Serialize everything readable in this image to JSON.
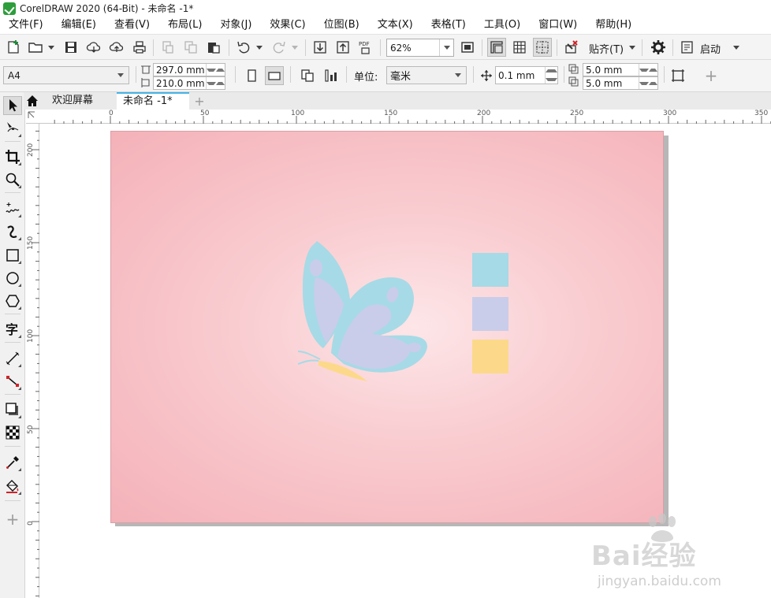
{
  "window": {
    "title": "CorelDRAW 2020 (64-Bit) - 未命名 -1*"
  },
  "menu": [
    "文件(F)",
    "编辑(E)",
    "查看(V)",
    "布局(L)",
    "对象(J)",
    "效果(C)",
    "位图(B)",
    "文本(X)",
    "表格(T)",
    "工具(O)",
    "窗口(W)",
    "帮助(H)"
  ],
  "toolbar": {
    "zoom": "62%",
    "snap_label": "贴齐(T)",
    "launch_label": "启动",
    "pdf_label": "PDF"
  },
  "propertybar": {
    "page_size": "A4",
    "width": "297.0 mm",
    "height": "210.0 mm",
    "unit_label": "单位:",
    "unit": "毫米",
    "nudge": "0.1 mm",
    "dup_x": "5.0 mm",
    "dup_y": "5.0 mm"
  },
  "tabs": {
    "welcome": "欢迎屏幕",
    "document": "未命名 -1*"
  },
  "ruler": {
    "h_labels": [
      "0",
      "50",
      "100",
      "150",
      "200",
      "250",
      "300",
      "350"
    ],
    "v_labels": [
      "200",
      "150",
      "100",
      "50",
      "0"
    ],
    "unit": "毫米"
  },
  "colors": {
    "page_center": "#fde6e8",
    "page_edge": "#f4b1b8",
    "butterfly_blue": "#a6dae6",
    "butterfly_lavender": "#c9cde9",
    "butterfly_yellow": "#fcd98a",
    "swatches": [
      "#a6dae6",
      "#c9cde9",
      "#fcd98a"
    ]
  },
  "watermark": {
    "text": "Bai经验",
    "url": "jingyan.baidu.com"
  }
}
